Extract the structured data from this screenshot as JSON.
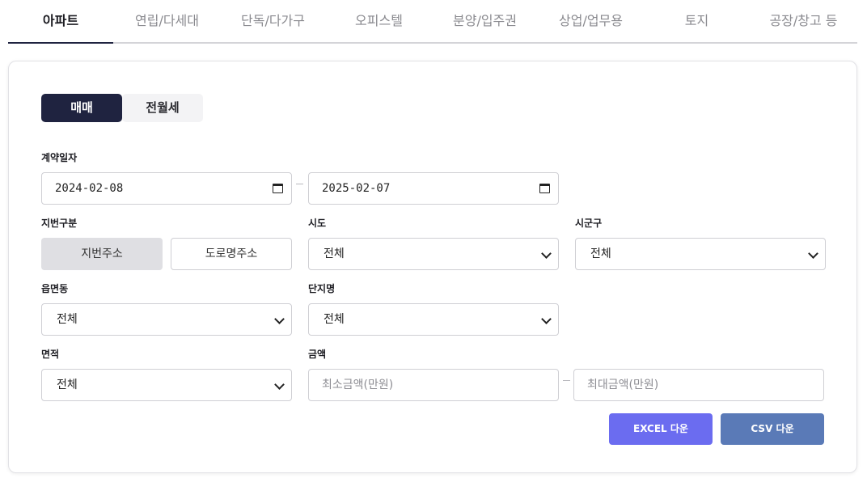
{
  "tabs": [
    {
      "label": "아파트",
      "active": true
    },
    {
      "label": "연립/다세대"
    },
    {
      "label": "단독/다가구"
    },
    {
      "label": "오피스텔"
    },
    {
      "label": "분양/입주권"
    },
    {
      "label": "상업/업무용"
    },
    {
      "label": "토지"
    },
    {
      "label": "공장/창고 등"
    }
  ],
  "trade_toggle": {
    "sale": "매매",
    "rent": "전월세",
    "selected": "매매"
  },
  "contract_date": {
    "label": "계약일자",
    "from": "2024-02-08",
    "to": "2025-02-07"
  },
  "lot_type": {
    "label": "지번구분",
    "jibun": "지번주소",
    "road": "도로명주소",
    "selected": "지번주소"
  },
  "sido": {
    "label": "시도",
    "value": "전체"
  },
  "sigungu": {
    "label": "시군구",
    "value": "전체"
  },
  "eupmyeondong": {
    "label": "읍면동",
    "value": "전체"
  },
  "complex": {
    "label": "단지명",
    "value": "전체"
  },
  "area": {
    "label": "면적",
    "value": "전체"
  },
  "price": {
    "label": "금액",
    "min_placeholder": "최소금액(만원)",
    "max_placeholder": "최대금액(만원)"
  },
  "actions": {
    "excel": "EXCEL 다운",
    "csv": "CSV 다운"
  },
  "colors": {
    "primary": "#1f2340",
    "excel": "#6b6cf0",
    "csv": "#5a7ab7"
  }
}
